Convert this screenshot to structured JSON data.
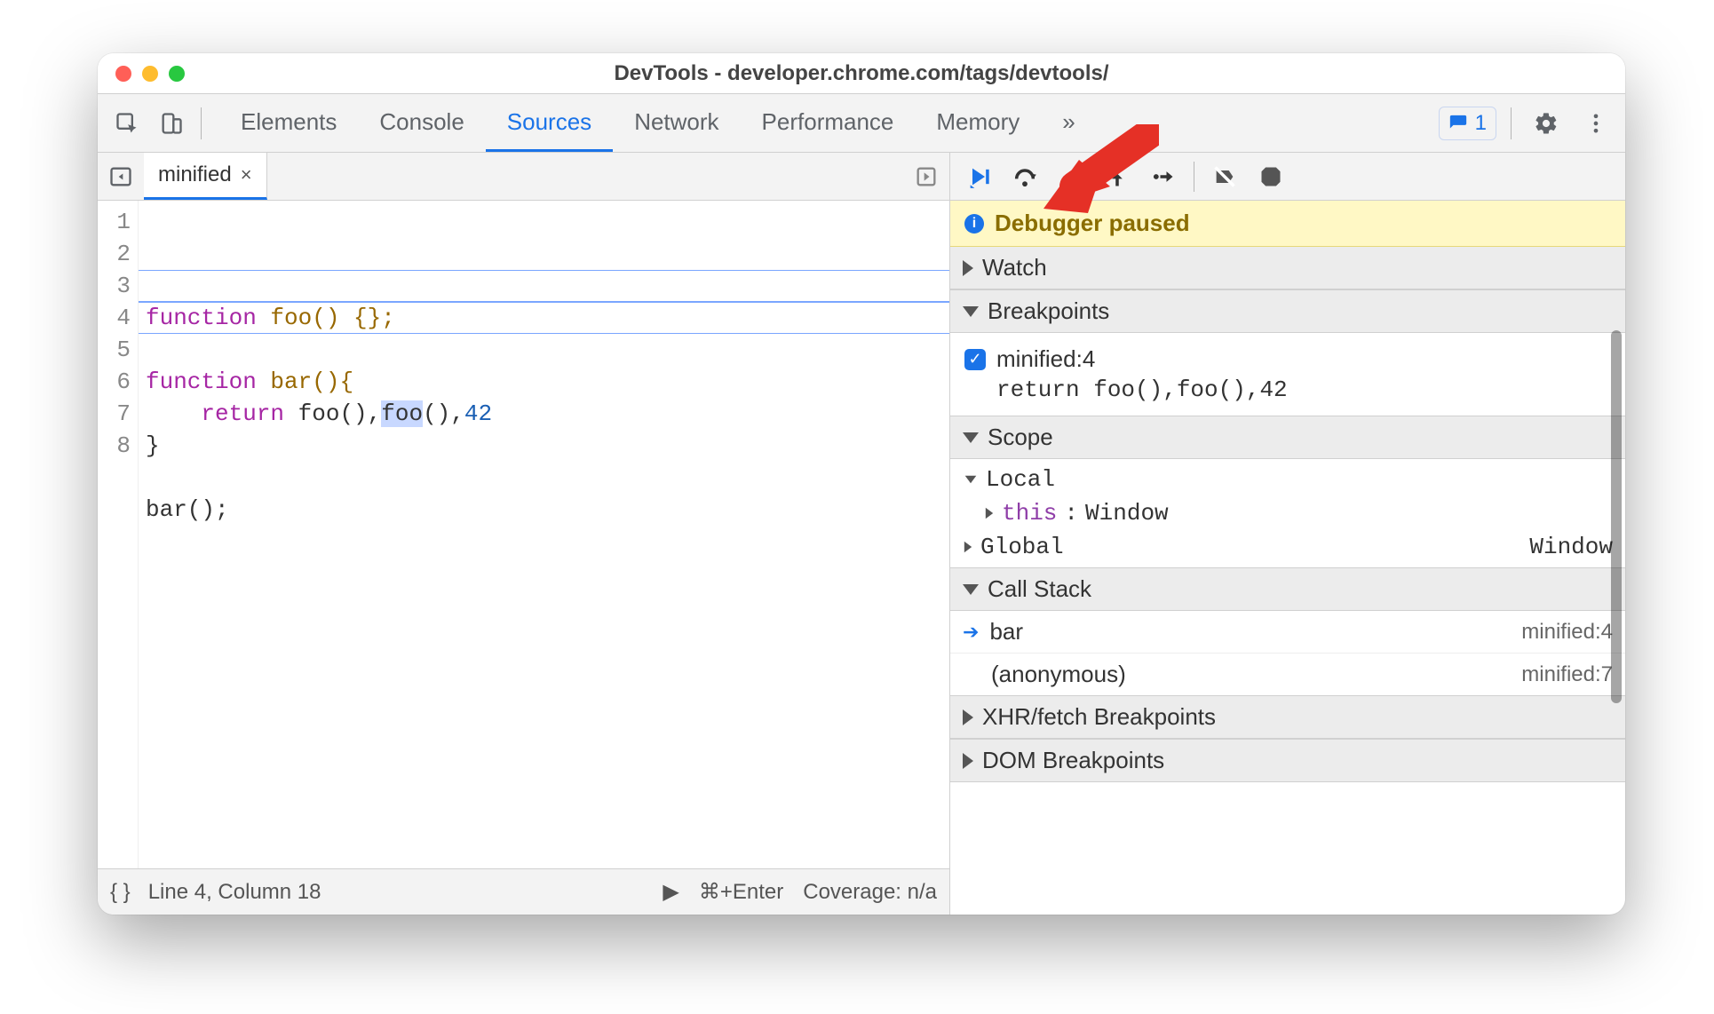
{
  "window": {
    "title": "DevTools - developer.chrome.com/tags/devtools/"
  },
  "tabs": {
    "items": [
      "Elements",
      "Console",
      "Sources",
      "Network",
      "Performance",
      "Memory"
    ],
    "active_index": 2,
    "overflow_label": "»",
    "issues_count": "1"
  },
  "file_tab": {
    "name": "minified"
  },
  "code": {
    "line_numbers": [
      "1",
      "2",
      "3",
      "4",
      "5",
      "6",
      "7",
      "8"
    ],
    "lines": {
      "l1a": "function",
      "l1b": " foo() {};",
      "l3a": "function",
      "l3b": " bar(){",
      "l4a": "    ",
      "l4b": "return",
      "l4c": " foo(),",
      "l4sel": "foo",
      "l4d": "(),",
      "l4num": "42",
      "l5": "}",
      "l7": "bar();"
    }
  },
  "status": {
    "braces": "{ }",
    "pos": "Line 4, Column 18",
    "run_hint": "⌘+Enter",
    "coverage": "Coverage: n/a"
  },
  "debugger": {
    "paused_msg": "Debugger paused",
    "watch": {
      "title": "Watch"
    },
    "breakpoints": {
      "title": "Breakpoints",
      "items": [
        {
          "label": "minified:4",
          "code": "return foo(),foo(),42"
        }
      ]
    },
    "scope": {
      "title": "Scope",
      "local_label": "Local",
      "this_label": "this",
      "this_value": "Window",
      "global_label": "Global",
      "global_value": "Window"
    },
    "callstack": {
      "title": "Call Stack",
      "frames": [
        {
          "name": "bar",
          "loc": "minified:4",
          "current": true
        },
        {
          "name": "(anonymous)",
          "loc": "minified:7",
          "current": false
        }
      ]
    },
    "xhr": {
      "title": "XHR/fetch Breakpoints"
    },
    "dom": {
      "title": "DOM Breakpoints"
    }
  }
}
